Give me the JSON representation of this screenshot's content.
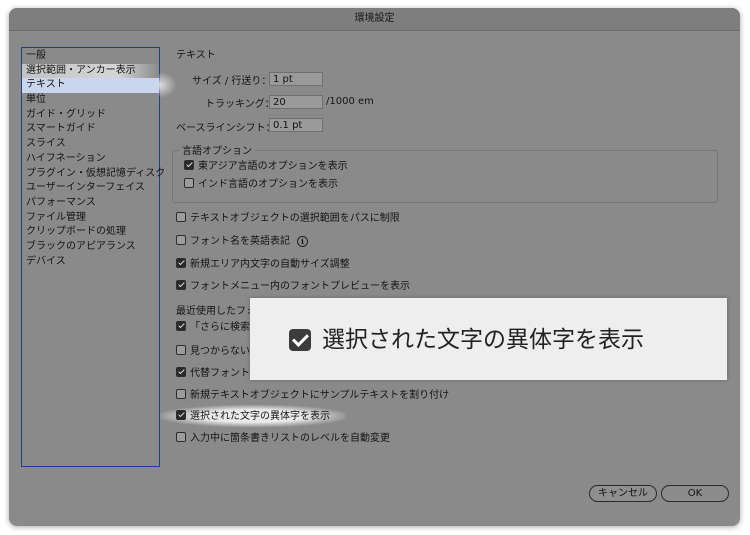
{
  "window": {
    "title": "環境設定"
  },
  "sidebar": {
    "items": [
      {
        "label": "一般"
      },
      {
        "label": "選択範囲・アンカー表示"
      },
      {
        "label": "テキスト"
      },
      {
        "label": "単位"
      },
      {
        "label": "ガイド・グリッド"
      },
      {
        "label": "スマートガイド"
      },
      {
        "label": "スライス"
      },
      {
        "label": "ハイフネーション"
      },
      {
        "label": "プラグイン・仮想記憶ディスク"
      },
      {
        "label": "ユーザーインターフェイス"
      },
      {
        "label": "パフォーマンス"
      },
      {
        "label": "ファイル管理"
      },
      {
        "label": "クリップボードの処理"
      },
      {
        "label": "ブラックのアピアランス"
      },
      {
        "label": "デバイス"
      }
    ],
    "selected_index": 2
  },
  "main": {
    "section_title": "テキスト",
    "size_leading_label": "サイズ / 行送り：",
    "size_leading_value": "1 pt",
    "tracking_label": "トラッキング：",
    "tracking_value": "20",
    "tracking_unit": "/1000 em",
    "baseline_label": "ベースラインシフト：",
    "baseline_value": "0.1 pt",
    "language_group": {
      "title": "言語オプション",
      "east_asian": {
        "label": "東アジア言語のオプションを表示",
        "checked": true
      },
      "indic": {
        "label": "インド言語のオプションを表示",
        "checked": false
      }
    },
    "options": [
      {
        "label": "テキストオブジェクトの選択範囲をパスに制限",
        "checked": false
      },
      {
        "label": "フォント名を英語表記",
        "checked": false
      },
      {
        "label": "新規エリア内文字の自動サイズ調整",
        "checked": true
      },
      {
        "label": "フォントメニュー内のフォントプレビューを表示",
        "checked": true
      }
    ],
    "recent_fonts_label": "最近使用したフォ",
    "partial_options": [
      {
        "label": "「さらに検索」",
        "checked": true
      },
      {
        "label": "見つからない字",
        "checked": false
      },
      {
        "label": "代替フォントを",
        "checked": true
      }
    ],
    "lower_options": [
      {
        "label": "新規テキストオブジェクトにサンプルテキストを割り付け",
        "checked": false
      },
      {
        "label": "選択された文字の異体字を表示",
        "checked": true
      },
      {
        "label": "入力中に箇条書きリストのレベルを自動変更",
        "checked": false
      }
    ]
  },
  "buttons": {
    "cancel": "キャンセル",
    "ok": "OK"
  },
  "callout": {
    "label": "選択された文字の異体字を表示",
    "checked": true
  }
}
